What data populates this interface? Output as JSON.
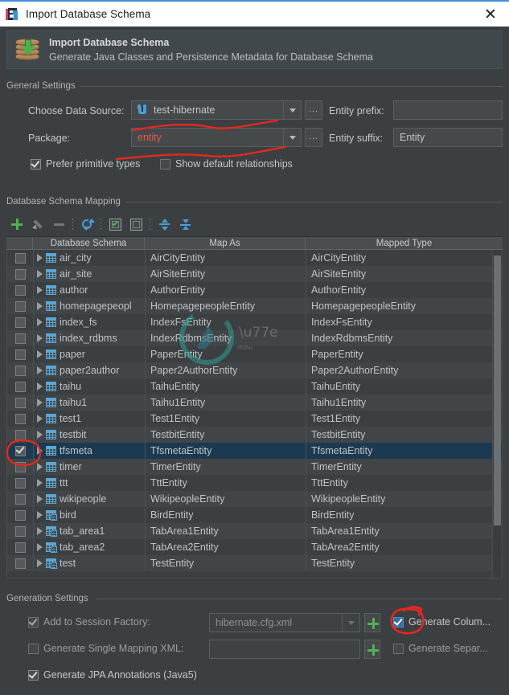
{
  "window": {
    "title": "Import Database Schema",
    "icon": "app-icon",
    "close_label": "✕"
  },
  "banner": {
    "icon": "database-import-icon",
    "title": "Import Database Schema",
    "subtitle": "Generate Java Classes and Persistence Metadata for Database Schema"
  },
  "general_settings": {
    "caption": "General Settings",
    "data_source": {
      "label": "Choose Data Source:",
      "value": "test-hibernate",
      "icon": "postgresql-icon",
      "browse_label": "..."
    },
    "package": {
      "label": "Package:",
      "value": "entity",
      "browse_label": "..."
    },
    "entity_prefix": {
      "label": "Entity prefix:",
      "value": "",
      "placeholder": ""
    },
    "entity_suffix": {
      "label": "Entity suffix:",
      "value": "Entity"
    },
    "prefer_primitive_types": {
      "label": "Prefer primitive types",
      "checked": true
    },
    "show_default_relationships": {
      "label": "Show default relationships",
      "checked": false
    }
  },
  "mapping": {
    "caption": "Database Schema Mapping",
    "toolbar": [
      {
        "name": "add-button",
        "icon": "plus-icon",
        "enabled": true
      },
      {
        "name": "edit-button",
        "icon": "pencil-icon",
        "enabled": false
      },
      {
        "name": "remove-button",
        "icon": "minus-icon",
        "enabled": false
      },
      {
        "name": "refresh-button",
        "icon": "refresh-icon",
        "enabled": true
      },
      {
        "name": "select-all-button",
        "icon": "checked-box-icon",
        "enabled": true
      },
      {
        "name": "select-none-button",
        "icon": "empty-box-icon",
        "enabled": true
      },
      {
        "name": "expand-all-button",
        "icon": "expand-all-icon",
        "enabled": true
      },
      {
        "name": "collapse-all-button",
        "icon": "collapse-all-icon",
        "enabled": true
      }
    ],
    "columns": [
      "",
      "Database Schema",
      "Map As",
      "Mapped Type"
    ],
    "rows": [
      {
        "checked": false,
        "icon": "table-icon",
        "schema": "air_city",
        "map_as": "AirCityEntity",
        "mapped_type": "AirCityEntity",
        "selected": false
      },
      {
        "checked": false,
        "icon": "table-icon",
        "schema": "air_site",
        "map_as": "AirSiteEntity",
        "mapped_type": "AirSiteEntity",
        "selected": false
      },
      {
        "checked": false,
        "icon": "table-icon",
        "schema": "author",
        "map_as": "AuthorEntity",
        "mapped_type": "AuthorEntity",
        "selected": false
      },
      {
        "checked": false,
        "icon": "table-icon",
        "schema": "homepagepeopl",
        "map_as": "HomepagepeopleEntity",
        "mapped_type": "HomepagepeopleEntity",
        "selected": false
      },
      {
        "checked": false,
        "icon": "table-icon",
        "schema": "index_fs",
        "map_as": "IndexFsEntity",
        "mapped_type": "IndexFsEntity",
        "selected": false
      },
      {
        "checked": false,
        "icon": "table-icon",
        "schema": "index_rdbms",
        "map_as": "IndexRdbmsEntity",
        "mapped_type": "IndexRdbmsEntity",
        "selected": false
      },
      {
        "checked": false,
        "icon": "table-icon",
        "schema": "paper",
        "map_as": "PaperEntity",
        "mapped_type": "PaperEntity",
        "selected": false
      },
      {
        "checked": false,
        "icon": "table-icon",
        "schema": "paper2author",
        "map_as": "Paper2AuthorEntity",
        "mapped_type": "Paper2AuthorEntity",
        "selected": false
      },
      {
        "checked": false,
        "icon": "table-icon",
        "schema": "taihu",
        "map_as": "TaihuEntity",
        "mapped_type": "TaihuEntity",
        "selected": false
      },
      {
        "checked": false,
        "icon": "table-icon",
        "schema": "taihu1",
        "map_as": "Taihu1Entity",
        "mapped_type": "Taihu1Entity",
        "selected": false
      },
      {
        "checked": false,
        "icon": "table-icon",
        "schema": "test1",
        "map_as": "Test1Entity",
        "mapped_type": "Test1Entity",
        "selected": false
      },
      {
        "checked": false,
        "icon": "table-icon",
        "schema": "testbit",
        "map_as": "TestbitEntity",
        "mapped_type": "TestbitEntity",
        "selected": false
      },
      {
        "checked": true,
        "icon": "table-icon",
        "schema": "tfsmeta",
        "map_as": "TfsmetaEntity",
        "mapped_type": "TfsmetaEntity",
        "selected": true
      },
      {
        "checked": false,
        "icon": "table-icon",
        "schema": "timer",
        "map_as": "TimerEntity",
        "mapped_type": "TimerEntity",
        "selected": false
      },
      {
        "checked": false,
        "icon": "table-icon",
        "schema": "ttt",
        "map_as": "TttEntity",
        "mapped_type": "TttEntity",
        "selected": false
      },
      {
        "checked": false,
        "icon": "table-icon",
        "schema": "wikipeople",
        "map_as": "WikipeopleEntity",
        "mapped_type": "WikipeopleEntity",
        "selected": false
      },
      {
        "checked": false,
        "icon": "view-icon",
        "schema": "bird",
        "map_as": "BirdEntity",
        "mapped_type": "BirdEntity",
        "selected": false
      },
      {
        "checked": false,
        "icon": "view-icon",
        "schema": "tab_area1",
        "map_as": "TabArea1Entity",
        "mapped_type": "TabArea1Entity",
        "selected": false
      },
      {
        "checked": false,
        "icon": "view-icon",
        "schema": "tab_area2",
        "map_as": "TabArea2Entity",
        "mapped_type": "TabArea2Entity",
        "selected": false
      },
      {
        "checked": false,
        "icon": "view-icon",
        "schema": "test",
        "map_as": "TestEntity",
        "mapped_type": "TestEntity",
        "selected": false
      }
    ]
  },
  "generation_settings": {
    "caption": "Generation Settings",
    "add_to_session_factory": {
      "label": "Add to Session Factory:",
      "checked": true,
      "enabled": false,
      "value": "hibernate.cfg.xml",
      "add_label": "+"
    },
    "generate_column_annotations": {
      "label": "Generate Colum...",
      "checked": true
    },
    "generate_single_mapping_xml": {
      "label": "Generate Single Mapping XML:",
      "checked": false,
      "value": "",
      "add_label": "+"
    },
    "generate_separate": {
      "label": "Generate Separ...",
      "checked": false
    },
    "generate_jpa_annotations": {
      "label": "Generate JPA Annotations (Java5)",
      "checked": true
    }
  },
  "colors": {
    "window_bg": "#3c3f41",
    "titlebar_bg": "#ffffff",
    "accent_blue": "#3b90d6",
    "selection": "#1b3a51",
    "annotation_red": "#e8271d",
    "link_red": "#e8564a",
    "green": "#52b152"
  }
}
